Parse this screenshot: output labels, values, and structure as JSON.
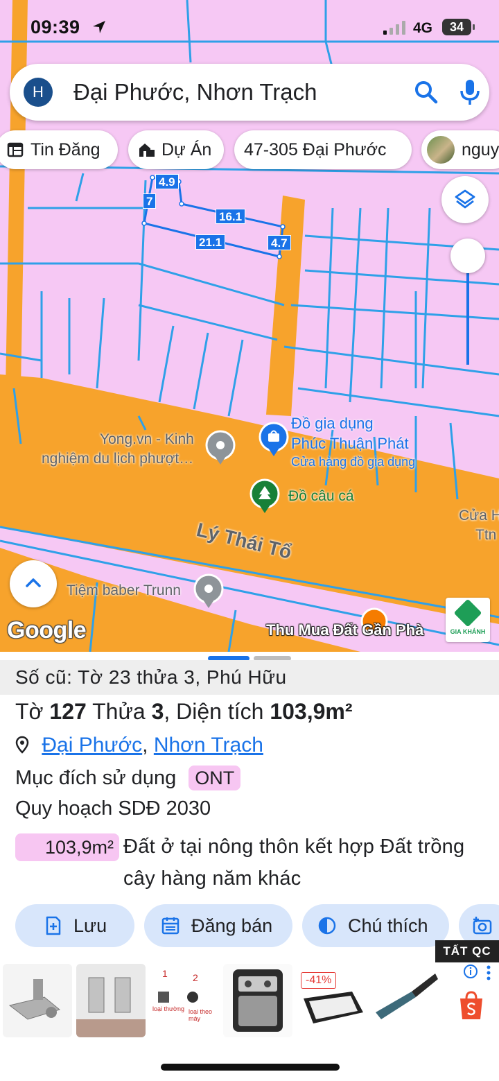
{
  "status_bar": {
    "time": "09:39",
    "network": "4G",
    "battery": "34"
  },
  "search": {
    "avatar_letter": "H",
    "query": "Đại Phước, Nhơn Trạch"
  },
  "chips": [
    {
      "label": "Tin Đăng",
      "icon": "newspaper-icon"
    },
    {
      "label": "Dự Án",
      "icon": "building-icon"
    },
    {
      "label": "47-305 Đại Phước"
    },
    {
      "label": "nguy"
    }
  ],
  "map": {
    "measurements": [
      "4.9",
      "7",
      "16.1",
      "21.1",
      "4.7"
    ],
    "pois": [
      {
        "name": "Yong.vn - Kinh",
        "name2": "nghiệm du lịch phượt…"
      },
      {
        "name": "Đồ gia dụng",
        "name2": "Phúc Thuận Phát",
        "category": "Cửa hàng đồ gia dụng"
      },
      {
        "name": "Đồ câu cá"
      },
      {
        "name": "Tiệm baber Trunn"
      },
      {
        "name": "Cửa H",
        "name2": "Ttn"
      }
    ],
    "road": "Lý Thái Tổ",
    "google": "Google",
    "ad_overlay": "Thu Mua Đất Gần Phà",
    "ad_logo_label": "GIA KHÁNH",
    "colors": {
      "residential": "#f6c8f4",
      "road": "#f7a32c",
      "parcel_line": "#2fa0e8",
      "accent": "#1a73e8"
    }
  },
  "parcel": {
    "old_id": "Số cũ: Tờ 23 thửa 3, Phú Hữu",
    "sheet_label": "Tờ",
    "sheet_no": "127",
    "plot_label": "Thửa",
    "plot_no": "3",
    "area_label": ", Diện tích",
    "area_value": "103,9m²",
    "ward": "Đại Phước",
    "district": "Nhơn Trạch",
    "purpose_label": "Mục đích sử dụng",
    "purpose_code": "ONT",
    "plan_label": "Quy hoạch SDĐ 2030",
    "plan_area": "103,9m²",
    "plan_desc": "Đất ở tại nông thôn kết hợp Đất trồng cây hàng năm khác"
  },
  "actions": [
    {
      "label": "Lưu",
      "icon": "bookmark-add-icon"
    },
    {
      "label": "Đăng bán",
      "icon": "calendar-icon"
    },
    {
      "label": "Chú thích",
      "icon": "contrast-icon"
    }
  ],
  "ad_banner": {
    "close_label": "TẤT QC",
    "tile3_label1": "loại thường",
    "tile3_label2": "loại theo máy",
    "tile3_num1": "1",
    "tile3_num2": "2",
    "discount": "-41%"
  }
}
